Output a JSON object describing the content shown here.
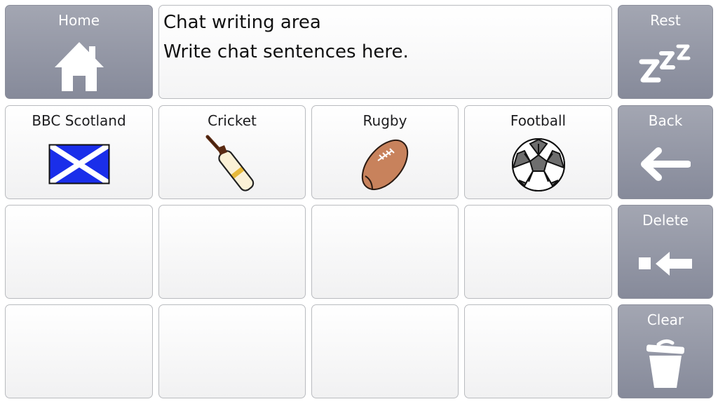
{
  "chat": {
    "line1": "Chat writing area",
    "line2": "Write chat sentences here."
  },
  "controls": {
    "home_label": "Home",
    "rest_label": "Rest",
    "back_label": "Back",
    "delete_label": "Delete",
    "clear_label": "Clear"
  },
  "tiles": [
    {
      "label": "BBC Scotland",
      "icon": "scotland-flag-icon"
    },
    {
      "label": "Cricket",
      "icon": "cricket-bat-icon"
    },
    {
      "label": "Rugby",
      "icon": "rugby-ball-icon"
    },
    {
      "label": "Football",
      "icon": "football-icon"
    }
  ],
  "colors": {
    "control_bg": "#8e919f",
    "tile_bg": "#ffffff",
    "flag_blue": "#1a2eea"
  }
}
